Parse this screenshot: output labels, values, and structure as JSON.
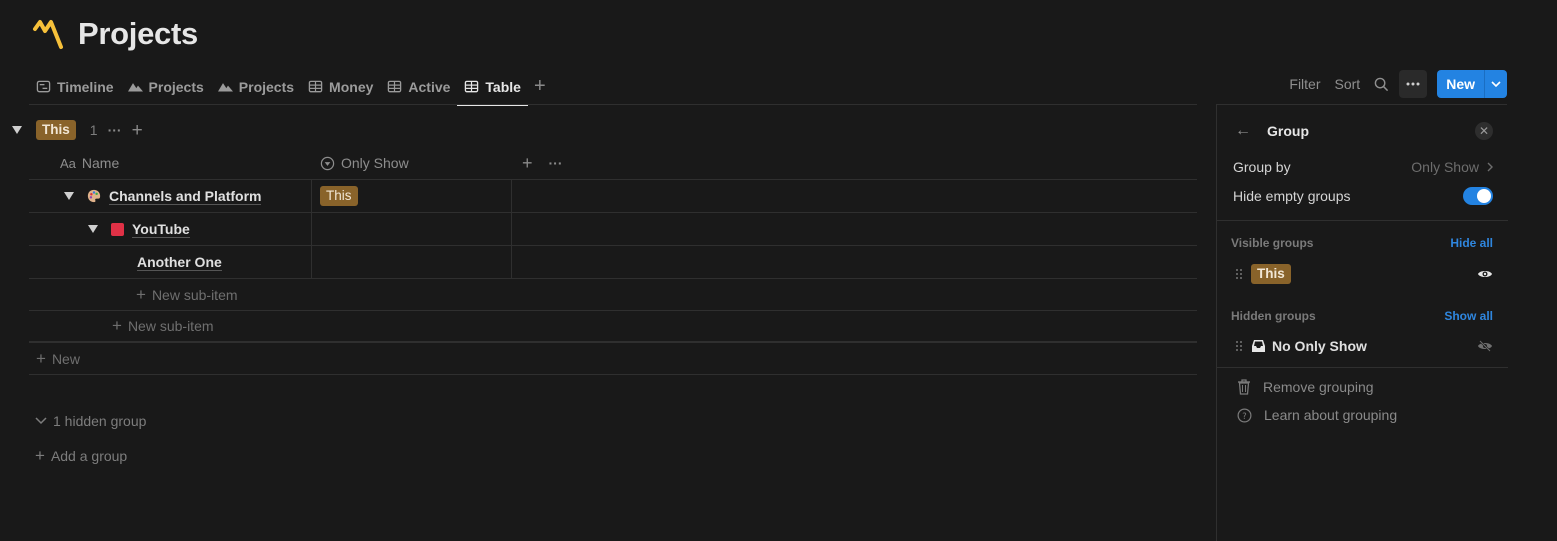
{
  "page": {
    "title": "Projects",
    "logo_icon": "m-logo-icon",
    "accent_color": "#f6c03a"
  },
  "tabs": [
    {
      "label": "Timeline",
      "icon": "timeline-icon",
      "active": false
    },
    {
      "label": "Projects",
      "icon": "mountain-icon",
      "active": false
    },
    {
      "label": "Projects",
      "icon": "mountain-icon",
      "active": false
    },
    {
      "label": "Money",
      "icon": "table-icon",
      "active": false
    },
    {
      "label": "Active",
      "icon": "table-icon",
      "active": false
    },
    {
      "label": "Table",
      "icon": "table-icon",
      "active": true
    }
  ],
  "toolbar": {
    "filter_label": "Filter",
    "sort_label": "Sort",
    "new_label": "New",
    "new_color": "#2383e2"
  },
  "group": {
    "tag_label": "This",
    "tag_color": "#89632a",
    "count": "1"
  },
  "table": {
    "columns": {
      "name": {
        "icon_text": "Aa",
        "label": "Name"
      },
      "only_show": {
        "label": "Only Show"
      }
    },
    "rows": [
      {
        "name": "Channels and Platform",
        "icon": "palette-icon",
        "only_show": "This",
        "expanded": true
      },
      {
        "name": "YouTube",
        "icon": "red-square-icon",
        "only_show": "",
        "expanded": true
      },
      {
        "name": "Another One",
        "icon": "",
        "only_show": ""
      }
    ],
    "new_sub_item_label": "New sub-item",
    "new_label": "New"
  },
  "footer": {
    "hidden_group_label": "1 hidden group",
    "add_group_label": "Add a group"
  },
  "panel": {
    "title": "Group",
    "group_by_label": "Group by",
    "group_by_value": "Only Show",
    "hide_empty_label": "Hide empty groups",
    "hide_empty_on": true,
    "visible_groups_label": "Visible groups",
    "hide_all_label": "Hide all",
    "visible_groups": [
      {
        "label": "This"
      }
    ],
    "hidden_groups_label": "Hidden groups",
    "show_all_label": "Show all",
    "hidden_groups": [
      {
        "label": "No Only Show"
      }
    ],
    "remove_grouping_label": "Remove grouping",
    "learn_label": "Learn about grouping",
    "link_color": "#2f86de"
  }
}
